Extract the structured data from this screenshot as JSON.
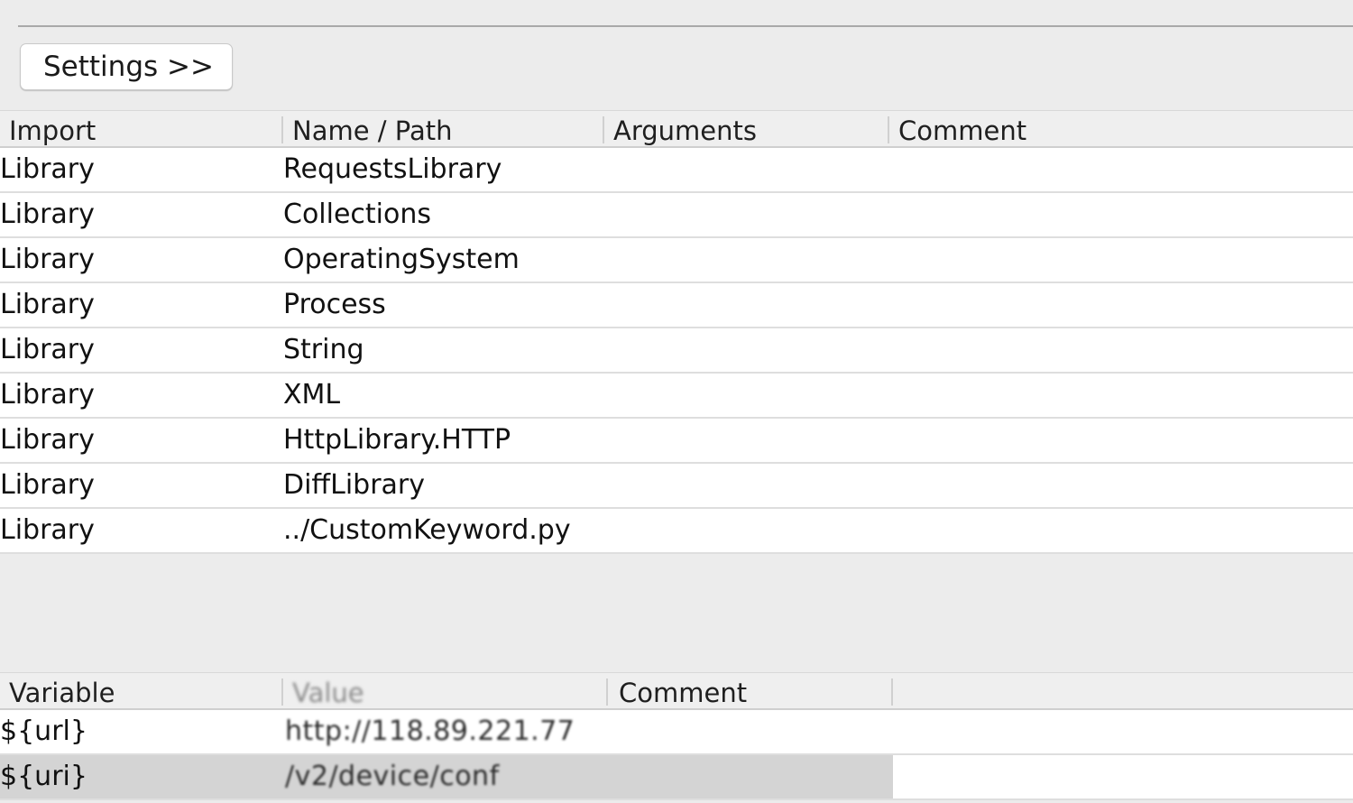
{
  "toolbar": {
    "settings_label": "Settings >>"
  },
  "imports": {
    "columns": [
      "Import",
      "Name / Path",
      "Arguments",
      "Comment"
    ],
    "rows": [
      {
        "import": "Library",
        "name": "RequestsLibrary"
      },
      {
        "import": "Library",
        "name": "Collections"
      },
      {
        "import": "Library",
        "name": "OperatingSystem"
      },
      {
        "import": "Library",
        "name": "Process"
      },
      {
        "import": "Library",
        "name": "String"
      },
      {
        "import": "Library",
        "name": "XML"
      },
      {
        "import": "Library",
        "name": "HttpLibrary.HTTP"
      },
      {
        "import": "Library",
        "name": "DiffLibrary"
      },
      {
        "import": "Library",
        "name": "../CustomKeyword.py"
      }
    ]
  },
  "variables": {
    "columns": [
      "Variable",
      "Value",
      "Comment"
    ],
    "rows": [
      {
        "variable": "${url}",
        "value": "http://118.89.221.77"
      },
      {
        "variable": "${uri}",
        "value": "/v2/device/conf"
      }
    ]
  }
}
